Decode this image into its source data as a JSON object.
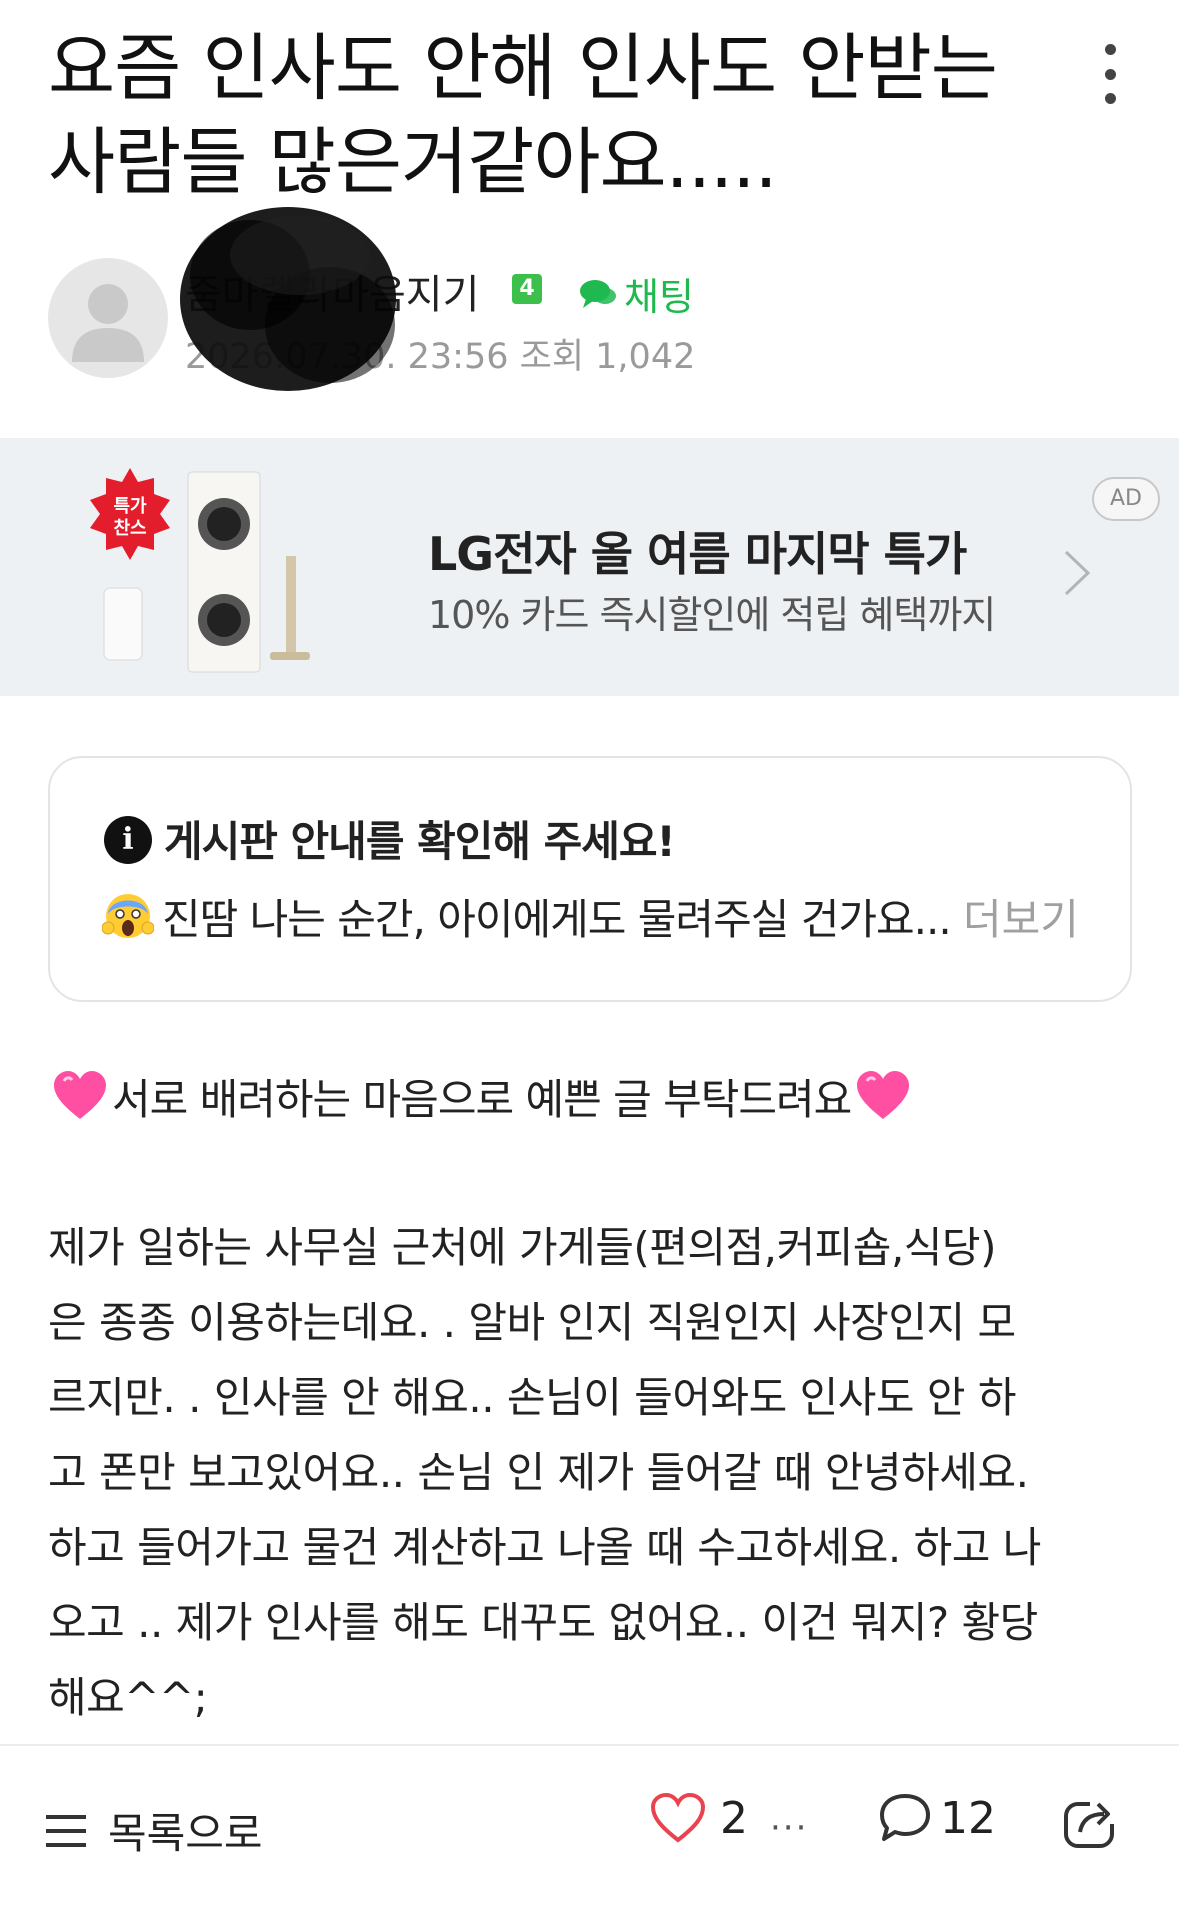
{
  "post": {
    "title": "요즘 인사도 안해 인사도 안받는 사람들 많은거같아요.....",
    "author": "줌마렐라마음지기",
    "level": "4",
    "chat_label": "채팅",
    "meta": "2026.07.30. 23:56 조회 1,042"
  },
  "ad": {
    "badge": "AD",
    "sticker": "특가 찬스",
    "title": "LG전자 올 여름 마지막 특가",
    "subtitle": "10% 카드 즉시할인에 적립 혜택까지"
  },
  "notice": {
    "title": "게시판 안내를 확인해 주세요!",
    "text": "진땀 나는 순간, 아이에게도 물려주실 건가요...",
    "more": "더보기"
  },
  "body": {
    "greeting": "서로 배려하는 마음으로 예쁜 글 부탁드려요",
    "text": "제가 일하는 사무실 근처에 가게들(편의점,커피숍,식당)\n은 종종 이용하는데요. .  알바 인지 직원인지 사장인지 모\n르지만. . 인사를 안 해요..  손님이 들어와도 인사도 안 하\n고 폰만 보고있어요.. 손님 인 제가 들어갈 때 안녕하세요.\n하고 들어가고 물건 계산하고 나올 때 수고하세요. 하고 나\n오고 .. 제가 인사를 해도 대꾸도 없어요.. 이건 뭐지?  황당\n해요^^;"
  },
  "bottom": {
    "list_label": "목록으로",
    "likes": "2",
    "likes_more": "···",
    "comments": "12"
  },
  "colors": {
    "chat_green": "#1fb950",
    "level_green": "#3dbf4b",
    "ad_bg": "#eef1f4",
    "heart_pink": "#ff4fa3",
    "like_red": "#e8434f"
  }
}
